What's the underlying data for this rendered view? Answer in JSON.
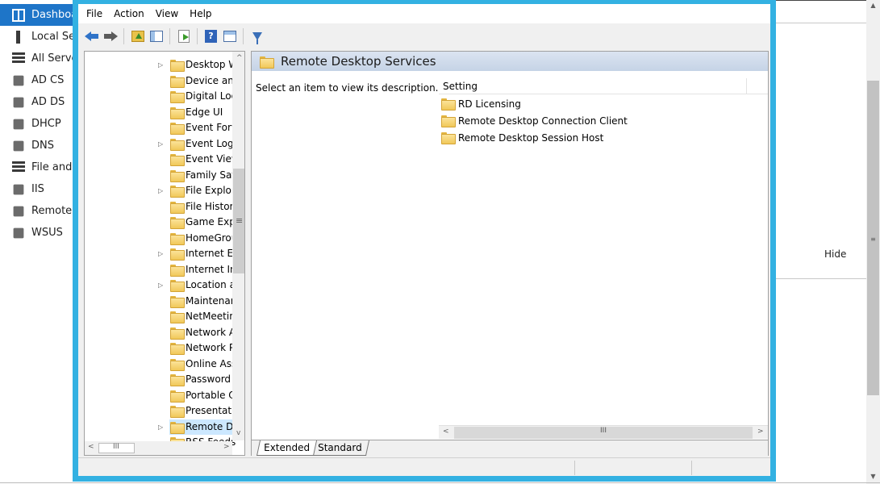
{
  "server_manager": {
    "nav_items": [
      {
        "label": "Dashboard",
        "icon": "dashboard-icon",
        "active": true
      },
      {
        "label": "Local Server",
        "icon": "server-icon"
      },
      {
        "label": "All Servers",
        "icon": "servers-icon"
      },
      {
        "label": "AD CS",
        "icon": "ad-cs-icon"
      },
      {
        "label": "AD DS",
        "icon": "ad-ds-icon"
      },
      {
        "label": "DHCP",
        "icon": "dhcp-icon"
      },
      {
        "label": "DNS",
        "icon": "dns-icon"
      },
      {
        "label": "File and Storage Services",
        "icon": "file-storage-icon"
      },
      {
        "label": "IIS",
        "icon": "iis-icon"
      },
      {
        "label": "Remote Desktop Services",
        "icon": "remote-desktop-icon"
      },
      {
        "label": "WSUS",
        "icon": "wsus-icon"
      }
    ],
    "hide_label": "Hide",
    "accent_color": "#1e75c8"
  },
  "gpo_editor": {
    "frame_color": "#33b1e2",
    "menu": [
      "File",
      "Action",
      "View",
      "Help"
    ],
    "toolbar_icons": [
      "back-icon",
      "forward-icon",
      "up-folder-icon",
      "show-hide-tree-icon",
      "export-list-icon",
      "help-icon",
      "properties-icon",
      "filter-icon"
    ],
    "tree": [
      {
        "label": "Desktop Window Manager",
        "expandable": true
      },
      {
        "label": "Device and Driver Compatibility",
        "expandable": false
      },
      {
        "label": "Digital Locker",
        "expandable": false
      },
      {
        "label": "Edge UI",
        "expandable": false
      },
      {
        "label": "Event Forwarding",
        "expandable": false
      },
      {
        "label": "Event Log Service",
        "expandable": true
      },
      {
        "label": "Event Viewer",
        "expandable": false
      },
      {
        "label": "Family Safety",
        "expandable": false
      },
      {
        "label": "File Explorer",
        "expandable": true
      },
      {
        "label": "File History",
        "expandable": false
      },
      {
        "label": "Game Explorer",
        "expandable": false
      },
      {
        "label": "HomeGroup",
        "expandable": false
      },
      {
        "label": "Internet Explorer",
        "expandable": true
      },
      {
        "label": "Internet Information Services",
        "expandable": false
      },
      {
        "label": "Location and Sensors",
        "expandable": true
      },
      {
        "label": "Maintenance Scheduler",
        "expandable": false
      },
      {
        "label": "NetMeeting",
        "expandable": false
      },
      {
        "label": "Network Access Protection",
        "expandable": false
      },
      {
        "label": "Network Projector",
        "expandable": false
      },
      {
        "label": "Online Assistance",
        "expandable": false
      },
      {
        "label": "Password Synchronization",
        "expandable": false
      },
      {
        "label": "Portable Operating System",
        "expandable": false
      },
      {
        "label": "Presentation Settings",
        "expandable": false
      },
      {
        "label": "Remote Desktop Services",
        "expandable": true,
        "selected": true
      },
      {
        "label": "RSS Feeds",
        "expandable": false
      }
    ],
    "content": {
      "title": "Remote Desktop Services",
      "description": "Select an item to view its description.",
      "column_header": "Setting",
      "items": [
        "RD Licensing",
        "Remote Desktop Connection Client",
        "Remote Desktop Session Host"
      ]
    },
    "tabs": [
      {
        "label": "Extended",
        "active": true
      },
      {
        "label": "Standard",
        "active": false
      }
    ]
  }
}
